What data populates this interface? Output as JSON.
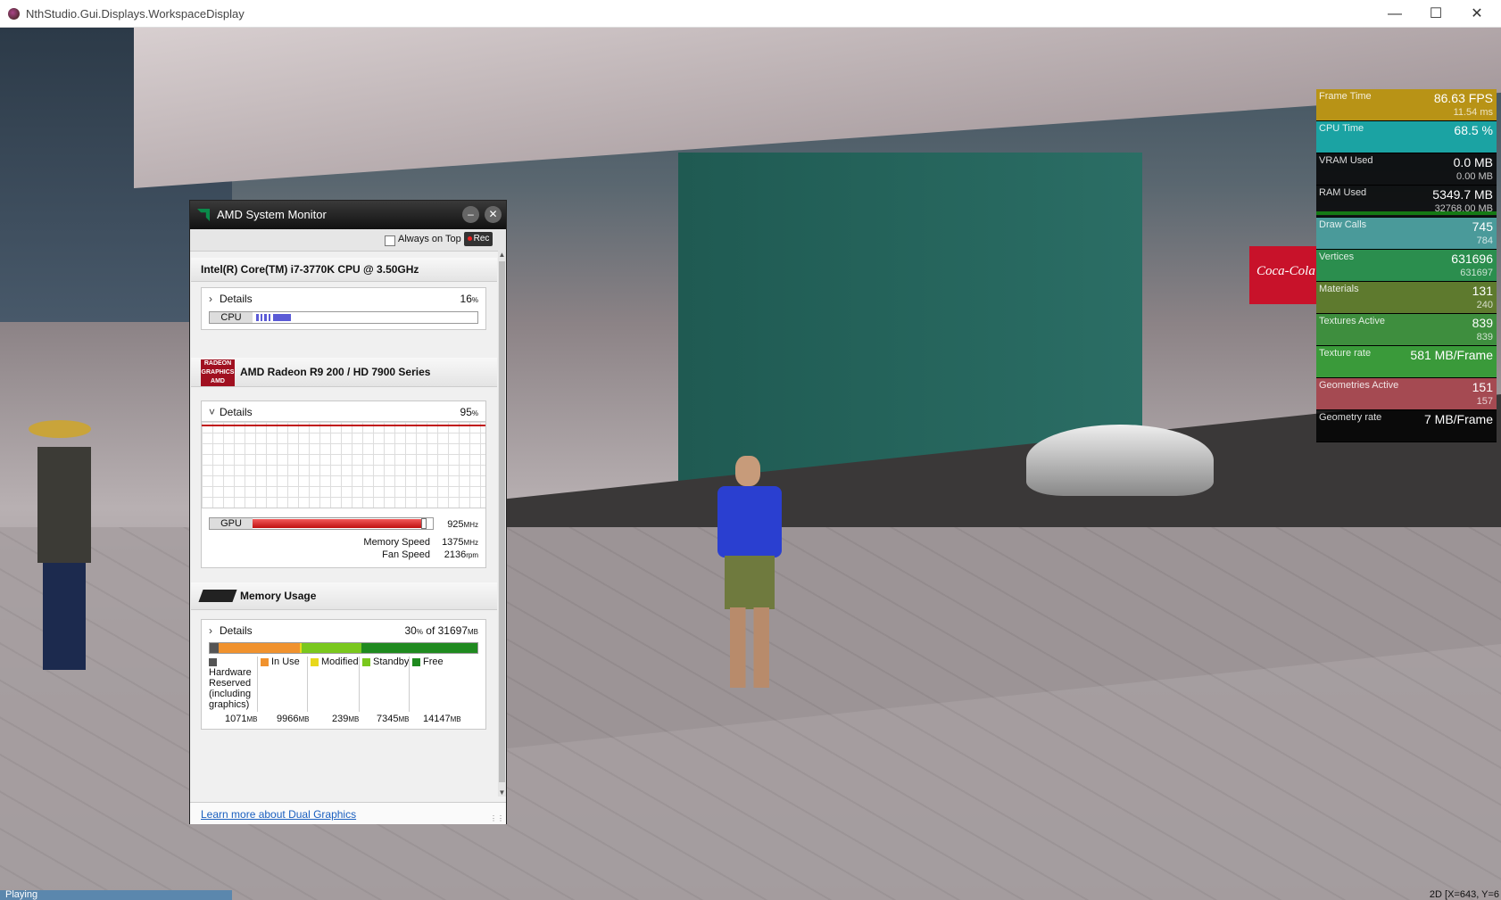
{
  "window": {
    "title": "NthStudio.Gui.Displays.WorkspaceDisplay"
  },
  "status": {
    "state": "Playing",
    "coords": "2D [X=643, Y=6"
  },
  "perf": [
    {
      "label": "Frame Time",
      "value": "86.63 FPS",
      "sub": "11.54 ms",
      "cls": "frame"
    },
    {
      "label": "CPU Time",
      "value": "68.5 %",
      "sub": "",
      "cls": "cpu"
    },
    {
      "label": "VRAM Used",
      "value": "0.0 MB",
      "sub": "0.00 MB",
      "cls": "vram"
    },
    {
      "label": "RAM Used",
      "value": "5349.7 MB",
      "sub": "32768.00 MB",
      "cls": "ram"
    },
    {
      "label": "Draw Calls",
      "value": "745",
      "sub": "784",
      "cls": "draw"
    },
    {
      "label": "Vertices",
      "value": "631696",
      "sub": "631697",
      "cls": "vert"
    },
    {
      "label": "Materials",
      "value": "131",
      "sub": "240",
      "cls": "mat"
    },
    {
      "label": "Textures Active",
      "value": "839",
      "sub": "839",
      "cls": "tex"
    },
    {
      "label": "Texture rate",
      "value": "581 MB/Frame",
      "sub": "",
      "cls": "texrate"
    },
    {
      "label": "Geometries Active",
      "value": "151",
      "sub": "157",
      "cls": "geo"
    },
    {
      "label": "Geometry rate",
      "value": "7 MB/Frame",
      "sub": "",
      "cls": "georate"
    }
  ],
  "amd": {
    "title": "AMD System Monitor",
    "always_on_top": "Always on Top",
    "rec": "Rec",
    "cpu": {
      "name": "Intel(R) Core(TM) i7-3770K CPU @ 3.50GHz",
      "details": "Details",
      "pct": "16",
      "pct_unit": "%",
      "bar_label": "CPU"
    },
    "gpu": {
      "name": "AMD Radeon R9 200 / HD 7900 Series",
      "details": "Details",
      "pct": "95",
      "pct_unit": "%",
      "bar_label": "GPU",
      "usage_fraction": 0.95,
      "clock": "925",
      "clock_unit": "MHz",
      "mem_speed_label": "Memory Speed",
      "mem_speed": "1375",
      "mem_speed_unit": "MHz",
      "fan_label": "Fan Speed",
      "fan": "2136",
      "fan_unit": "rpm"
    },
    "memory": {
      "header": "Memory Usage",
      "details": "Details",
      "pct": "30",
      "pct_unit": "%",
      "of": " of 31697",
      "of_unit": "MB",
      "legend": [
        {
          "label": "Hardware Reserved (including graphics)",
          "value": "1071",
          "unit": "MB",
          "color": "#555555"
        },
        {
          "label": "In Use",
          "value": "9966",
          "unit": "MB",
          "color": "#f0922e"
        },
        {
          "label": "Modified",
          "value": "239",
          "unit": "MB",
          "color": "#e8d81c"
        },
        {
          "label": "Standby",
          "value": "7345",
          "unit": "MB",
          "color": "#7ac81e"
        },
        {
          "label": "Free",
          "value": "14147",
          "unit": "MB",
          "color": "#1f8a1f"
        }
      ]
    },
    "footer_link": "Learn more about Dual Graphics"
  }
}
